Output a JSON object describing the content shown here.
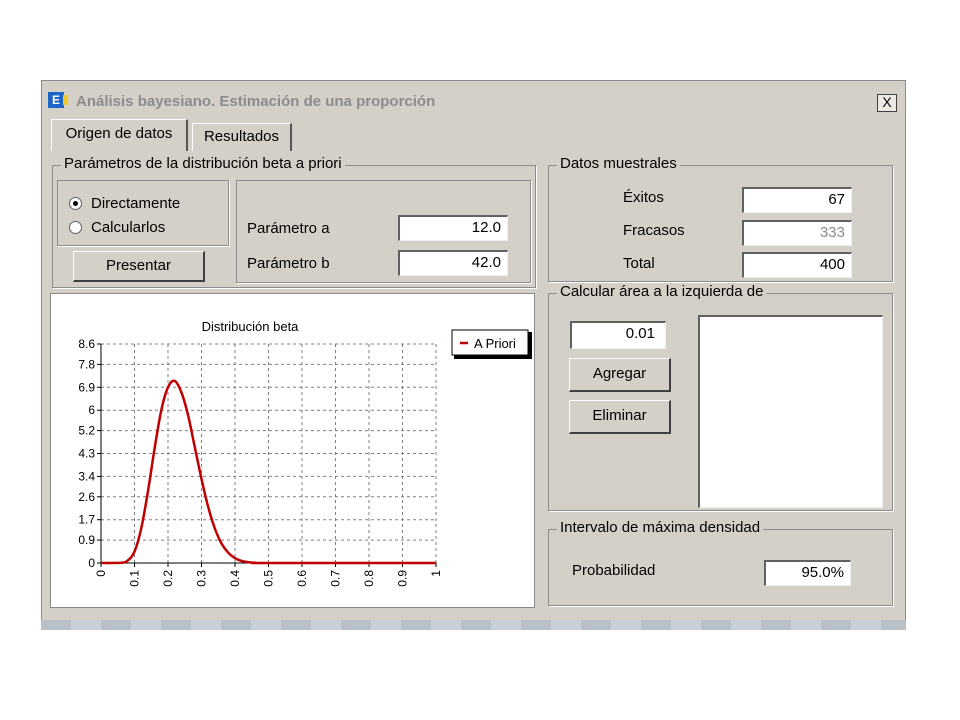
{
  "window": {
    "title": "Análisis bayesiano. Estimación de una proporción",
    "close_label": "X"
  },
  "tabs": [
    {
      "label": "Origen de datos"
    },
    {
      "label": "Resultados"
    }
  ],
  "prior": {
    "group_title": "Parámetros de la distribución beta a priori",
    "radio_options": [
      {
        "label": "Directamente",
        "checked": true
      },
      {
        "label": "Calcularlos",
        "checked": false
      }
    ],
    "present_button": "Presentar",
    "param_a_label": "Parámetro a",
    "param_a_value": "12.0",
    "param_b_label": "Parámetro b",
    "param_b_value": "42.0"
  },
  "sample": {
    "group_title": "Datos muestrales",
    "exitos_label": "Éxitos",
    "exitos_value": "67",
    "fracasos_label": "Fracasos",
    "fracasos_value": "333",
    "total_label": "Total",
    "total_value": "400"
  },
  "area": {
    "group_title": "Calcular área a la izquierda de",
    "input_value": "0.01",
    "add_button": "Agregar",
    "remove_button": "Eliminar"
  },
  "hdi": {
    "group_title": "Intervalo de máxima densidad",
    "prob_label": "Probabilidad",
    "prob_value": "95.0%"
  },
  "colors": {
    "curve": "#c00000",
    "window_bg": "#d4d0c8"
  },
  "chart_data": {
    "type": "line",
    "title": "Distribución beta",
    "legend_position": "top-right",
    "grid": true,
    "x_ticks": [
      "0",
      "0.1",
      "0.2",
      "0.3",
      "0.4",
      "0.5",
      "0.6",
      "0.7",
      "0.8",
      "0.9",
      "1"
    ],
    "y_ticks": [
      "0",
      "0.9",
      "1.7",
      "2.6",
      "3.4",
      "4.3",
      "5.2",
      "6",
      "6.9",
      "7.8",
      "8.6"
    ],
    "xlim": [
      0,
      1
    ],
    "ylim": [
      0,
      8.6
    ],
    "series": [
      {
        "name": "A Priori",
        "x": [
          0,
          0.06,
          0.08,
          0.1,
          0.12,
          0.14,
          0.16,
          0.18,
          0.2,
          0.22,
          0.24,
          0.26,
          0.28,
          0.3,
          0.32,
          0.34,
          0.36,
          0.38,
          0.4,
          0.42,
          0.44,
          0.46,
          0.5,
          1.0
        ],
        "y": [
          0,
          0.01,
          0.1,
          0.45,
          1.35,
          2.8,
          4.5,
          6.0,
          6.9,
          7.15,
          6.7,
          5.8,
          4.55,
          3.3,
          2.2,
          1.35,
          0.76,
          0.4,
          0.19,
          0.08,
          0.03,
          0.01,
          0,
          0
        ]
      }
    ]
  }
}
